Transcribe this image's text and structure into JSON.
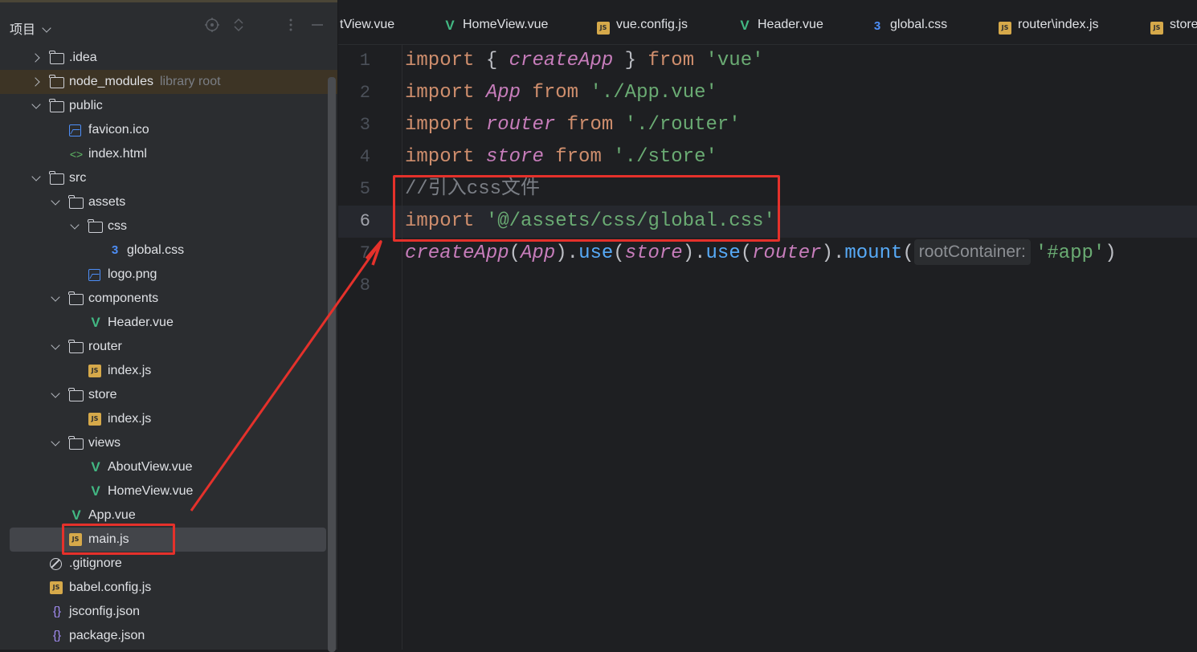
{
  "project_panel": {
    "title": "项目",
    "tree": [
      {
        "label": ".idea",
        "kind": "folder",
        "depth": 0,
        "chevron": "right"
      },
      {
        "label": "node_modules",
        "hint": "library root",
        "kind": "folder",
        "depth": 0,
        "chevron": "right",
        "highlight": true
      },
      {
        "label": "public",
        "kind": "folder",
        "depth": 0,
        "chevron": "down"
      },
      {
        "label": "favicon.ico",
        "kind": "image",
        "depth": 1
      },
      {
        "label": "index.html",
        "kind": "html",
        "depth": 1
      },
      {
        "label": "src",
        "kind": "folder",
        "depth": 0,
        "chevron": "down"
      },
      {
        "label": "assets",
        "kind": "folder",
        "depth": 1,
        "chevron": "down"
      },
      {
        "label": "css",
        "kind": "folder",
        "depth": 2,
        "chevron": "down"
      },
      {
        "label": "global.css",
        "kind": "css",
        "depth": 3
      },
      {
        "label": "logo.png",
        "kind": "image",
        "depth": 2
      },
      {
        "label": "components",
        "kind": "folder",
        "depth": 1,
        "chevron": "down"
      },
      {
        "label": "Header.vue",
        "kind": "vue",
        "depth": 2
      },
      {
        "label": "router",
        "kind": "folder",
        "depth": 1,
        "chevron": "down"
      },
      {
        "label": "index.js",
        "kind": "js",
        "depth": 2
      },
      {
        "label": "store",
        "kind": "folder",
        "depth": 1,
        "chevron": "down"
      },
      {
        "label": "index.js",
        "kind": "js",
        "depth": 2
      },
      {
        "label": "views",
        "kind": "folder",
        "depth": 1,
        "chevron": "down"
      },
      {
        "label": "AboutView.vue",
        "kind": "vue",
        "depth": 2
      },
      {
        "label": "HomeView.vue",
        "kind": "vue",
        "depth": 2
      },
      {
        "label": "App.vue",
        "kind": "vue",
        "depth": 1
      },
      {
        "label": "main.js",
        "kind": "js",
        "depth": 1,
        "selected": true
      },
      {
        "label": ".gitignore",
        "kind": "ignore",
        "depth": 0
      },
      {
        "label": "babel.config.js",
        "kind": "js",
        "depth": 0
      },
      {
        "label": "jsconfig.json",
        "kind": "json",
        "depth": 0
      },
      {
        "label": "package.json",
        "kind": "json",
        "depth": 0
      }
    ]
  },
  "tabs": [
    {
      "label": "tView.vue",
      "kind": "none"
    },
    {
      "label": "HomeView.vue",
      "kind": "vue"
    },
    {
      "label": "vue.config.js",
      "kind": "js"
    },
    {
      "label": "Header.vue",
      "kind": "vue"
    },
    {
      "label": "global.css",
      "kind": "css"
    },
    {
      "label": "router\\index.js",
      "kind": "js"
    },
    {
      "label": "store",
      "kind": "js"
    }
  ],
  "editor": {
    "line_numbers": [
      "1",
      "2",
      "3",
      "4",
      "5",
      "6",
      "7",
      "8"
    ],
    "active_line": 6,
    "lines": [
      [
        {
          "t": "import",
          "c": "kw"
        },
        {
          "t": " { ",
          "c": "plain"
        },
        {
          "t": "createApp",
          "c": "fn"
        },
        {
          "t": " } ",
          "c": "plain"
        },
        {
          "t": "from",
          "c": "kw"
        },
        {
          "t": " ",
          "c": "plain"
        },
        {
          "t": "'vue'",
          "c": "str"
        }
      ],
      [
        {
          "t": "import",
          "c": "kw"
        },
        {
          "t": " ",
          "c": "plain"
        },
        {
          "t": "App",
          "c": "fn"
        },
        {
          "t": " ",
          "c": "plain"
        },
        {
          "t": "from",
          "c": "kw"
        },
        {
          "t": " ",
          "c": "plain"
        },
        {
          "t": "'./App.vue'",
          "c": "str"
        }
      ],
      [
        {
          "t": "import",
          "c": "kw"
        },
        {
          "t": " ",
          "c": "plain"
        },
        {
          "t": "router",
          "c": "fn"
        },
        {
          "t": " ",
          "c": "plain"
        },
        {
          "t": "from",
          "c": "kw"
        },
        {
          "t": " ",
          "c": "plain"
        },
        {
          "t": "'./router'",
          "c": "str"
        }
      ],
      [
        {
          "t": "import",
          "c": "kw"
        },
        {
          "t": " ",
          "c": "plain"
        },
        {
          "t": "store",
          "c": "fn"
        },
        {
          "t": " ",
          "c": "plain"
        },
        {
          "t": "from",
          "c": "kw"
        },
        {
          "t": " ",
          "c": "plain"
        },
        {
          "t": "'./store'",
          "c": "str"
        }
      ],
      [
        {
          "t": "//引入css文件",
          "c": "cmt"
        }
      ],
      [
        {
          "t": "import",
          "c": "kw"
        },
        {
          "t": " ",
          "c": "plain"
        },
        {
          "t": "'@/assets/css/global.css'",
          "c": "str"
        }
      ],
      [
        {
          "t": "createApp",
          "c": "fn"
        },
        {
          "t": "(",
          "c": "plain"
        },
        {
          "t": "App",
          "c": "fn"
        },
        {
          "t": ").",
          "c": "plain"
        },
        {
          "t": "use",
          "c": "meth"
        },
        {
          "t": "(",
          "c": "plain"
        },
        {
          "t": "store",
          "c": "fn"
        },
        {
          "t": ").",
          "c": "plain"
        },
        {
          "t": "use",
          "c": "meth"
        },
        {
          "t": "(",
          "c": "plain"
        },
        {
          "t": "router",
          "c": "fn"
        },
        {
          "t": ").",
          "c": "plain"
        },
        {
          "t": "mount",
          "c": "meth"
        },
        {
          "t": "(",
          "c": "plain"
        },
        {
          "t": "rootContainer:",
          "c": "hint"
        },
        {
          "t": "'#app'",
          "c": "str"
        },
        {
          "t": ")",
          "c": "plain"
        }
      ],
      []
    ]
  },
  "colors": {
    "keyword": "#cf8e6d",
    "identifier_italic": "#c77dbb",
    "string": "#6aab73",
    "method": "#57aaf7",
    "comment": "#7a7e85",
    "annotation_red": "#e5312b"
  },
  "icons": {
    "header": [
      "locate-icon",
      "expand-collapse-icon",
      "more-options-icon",
      "hide-icon"
    ]
  }
}
